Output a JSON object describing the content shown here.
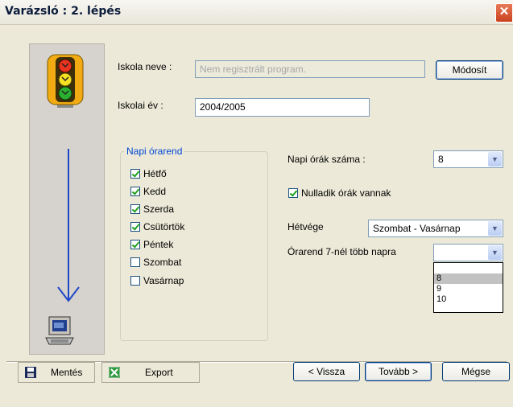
{
  "window": {
    "title": "Varázsló : 2. lépés",
    "close_glyph": "✕"
  },
  "form": {
    "school_name_label": "Iskola neve :",
    "school_name_placeholder": "Nem regisztrált program.",
    "modify_button": "Módosít",
    "school_year_label": "Iskolai év :",
    "school_year_value": "2004/2005"
  },
  "days_group": {
    "label": "Napi órarend",
    "days": [
      {
        "label": "Hétfő",
        "checked": true
      },
      {
        "label": "Kedd",
        "checked": true
      },
      {
        "label": "Szerda",
        "checked": true
      },
      {
        "label": "Csütörtök",
        "checked": true
      },
      {
        "label": "Péntek",
        "checked": true
      },
      {
        "label": "Szombat",
        "checked": false
      },
      {
        "label": "Vasárnap",
        "checked": false
      }
    ]
  },
  "settings": {
    "hours_label": "Napi órák száma :",
    "hours_value": "8",
    "zero_hours_label": "Nulladik órák vannak",
    "zero_hours_checked": true,
    "weekend_label": "Hétvége",
    "weekend_value": "Szombat - Vasárnap",
    "multi_day_label": "Órarend 7-nél több napra",
    "multi_day_value": "",
    "multi_day_options": [
      "",
      "8",
      "9",
      "10"
    ],
    "multi_day_highlighted": "8"
  },
  "footer": {
    "save_button": "Mentés",
    "export_button": "Export",
    "back_button": "< Vissza",
    "next_button": "Tovább >",
    "cancel_button": "Mégse"
  },
  "colors": {
    "accent": "#0046d5",
    "arrow": "#1e47c8"
  },
  "icons": [
    "traffic-light-icon",
    "down-arrow-icon",
    "computer-icon",
    "floppy-save-icon",
    "excel-export-icon",
    "close-icon",
    "chevron-down-icon"
  ]
}
